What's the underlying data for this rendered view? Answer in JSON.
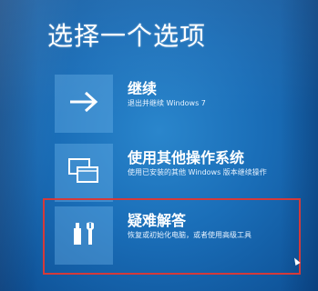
{
  "title": "选择一个选项",
  "options": [
    {
      "title": "继续",
      "desc": "退出并继续 Windows 7",
      "icon": "arrow-right-icon"
    },
    {
      "title": "使用其他操作系统",
      "desc": "使用已安装的其他 Windows 版本继续操作",
      "icon": "windows-stack-icon"
    },
    {
      "title": "疑难解答",
      "desc": "恢复或初始化电脑，或者使用高级工具",
      "icon": "tools-icon"
    }
  ],
  "colors": {
    "background": "#1a6eb8",
    "highlight_border": "#d43a3a",
    "tile": "#78bef0"
  }
}
